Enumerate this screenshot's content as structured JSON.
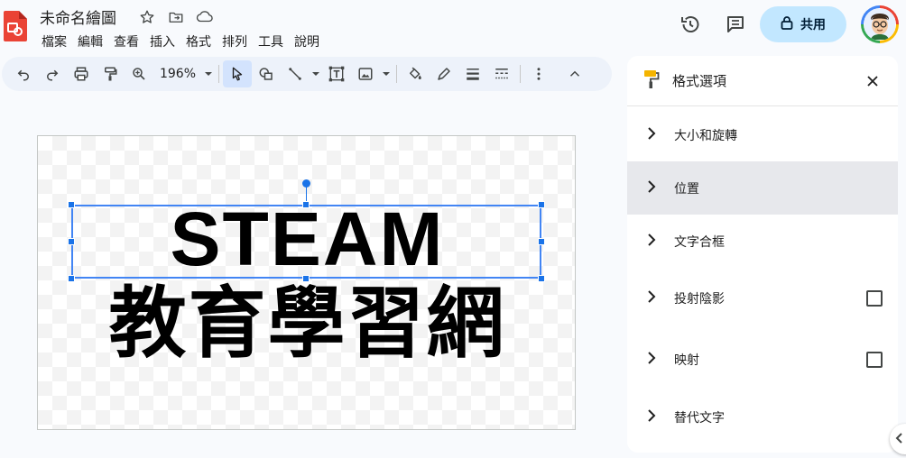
{
  "document": {
    "title": "未命名繪圖"
  },
  "menu": [
    "檔案",
    "編輯",
    "查看",
    "插入",
    "格式",
    "排列",
    "工具",
    "說明"
  ],
  "header": {
    "share_label": "共用"
  },
  "toolbar": {
    "zoom": "196%"
  },
  "canvas": {
    "line1": "STEAM",
    "line2": "教育學習網"
  },
  "format_panel": {
    "title": "格式選項",
    "sections": [
      {
        "label": "大小和旋轉",
        "checkbox": false,
        "highlighted": false
      },
      {
        "label": "位置",
        "checkbox": false,
        "highlighted": true
      },
      {
        "label": "文字合框",
        "checkbox": false,
        "highlighted": false
      },
      {
        "label": "投射陰影",
        "checkbox": true,
        "highlighted": false
      },
      {
        "label": "映射",
        "checkbox": true,
        "highlighted": false
      },
      {
        "label": "替代文字",
        "checkbox": false,
        "highlighted": false
      }
    ]
  },
  "colors": {
    "accent": "#1a73e8",
    "share_bg": "#c2e7ff",
    "app_red": "#ea4335",
    "toolbar_bg": "#edf2fa"
  }
}
